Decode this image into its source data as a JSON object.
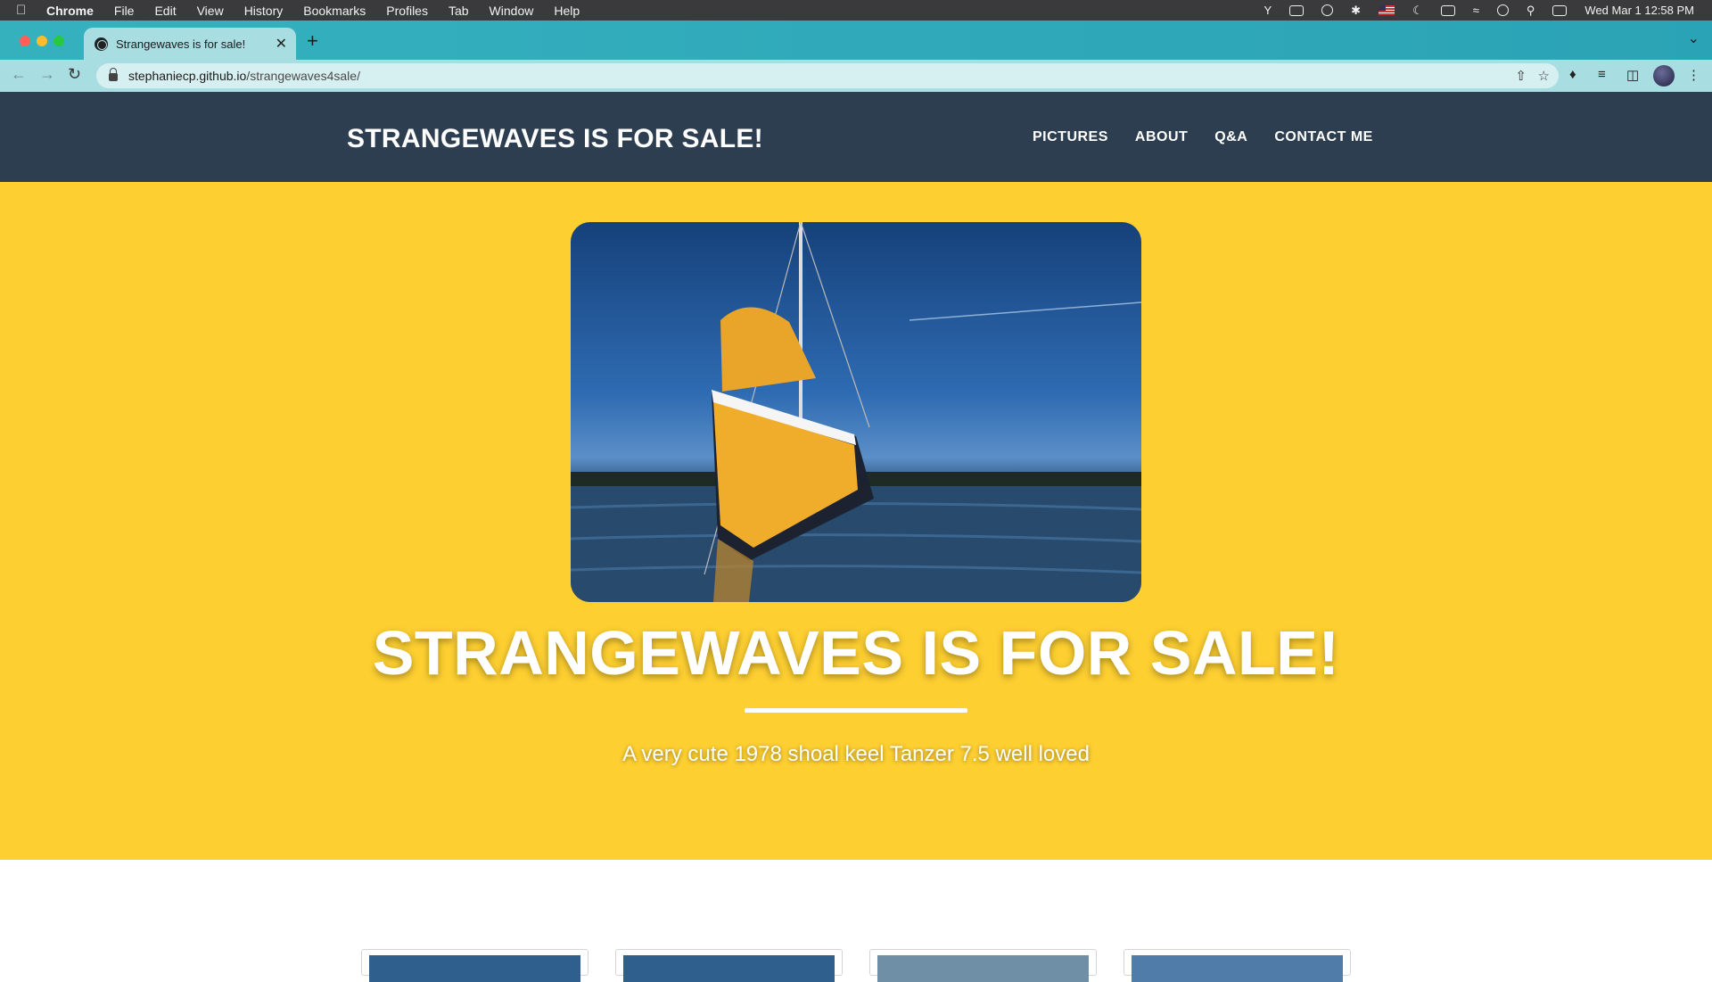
{
  "menubar": {
    "app": "Chrome",
    "items": [
      "File",
      "Edit",
      "View",
      "History",
      "Bookmarks",
      "Profiles",
      "Tab",
      "Window",
      "Help"
    ],
    "clock": "Wed Mar 1  12:58 PM"
  },
  "browser": {
    "tab_title": "Strangewaves is for sale!",
    "url_host": "stephaniecp.github.io",
    "url_path": "/strangewaves4sale/"
  },
  "site": {
    "brand": "STRANGEWAVES IS FOR SALE!",
    "nav": [
      "PICTURES",
      "ABOUT",
      "Q&A",
      "CONTACT ME"
    ],
    "hero_title": "STRANGEWAVES IS FOR SALE!",
    "tagline": "A very cute 1978 shoal keel Tanzer 7.5 well loved"
  },
  "colors": {
    "nav_bg": "#2c3e50",
    "masthead_bg": "#fdcf31",
    "tab_strip": "#35b1be"
  }
}
